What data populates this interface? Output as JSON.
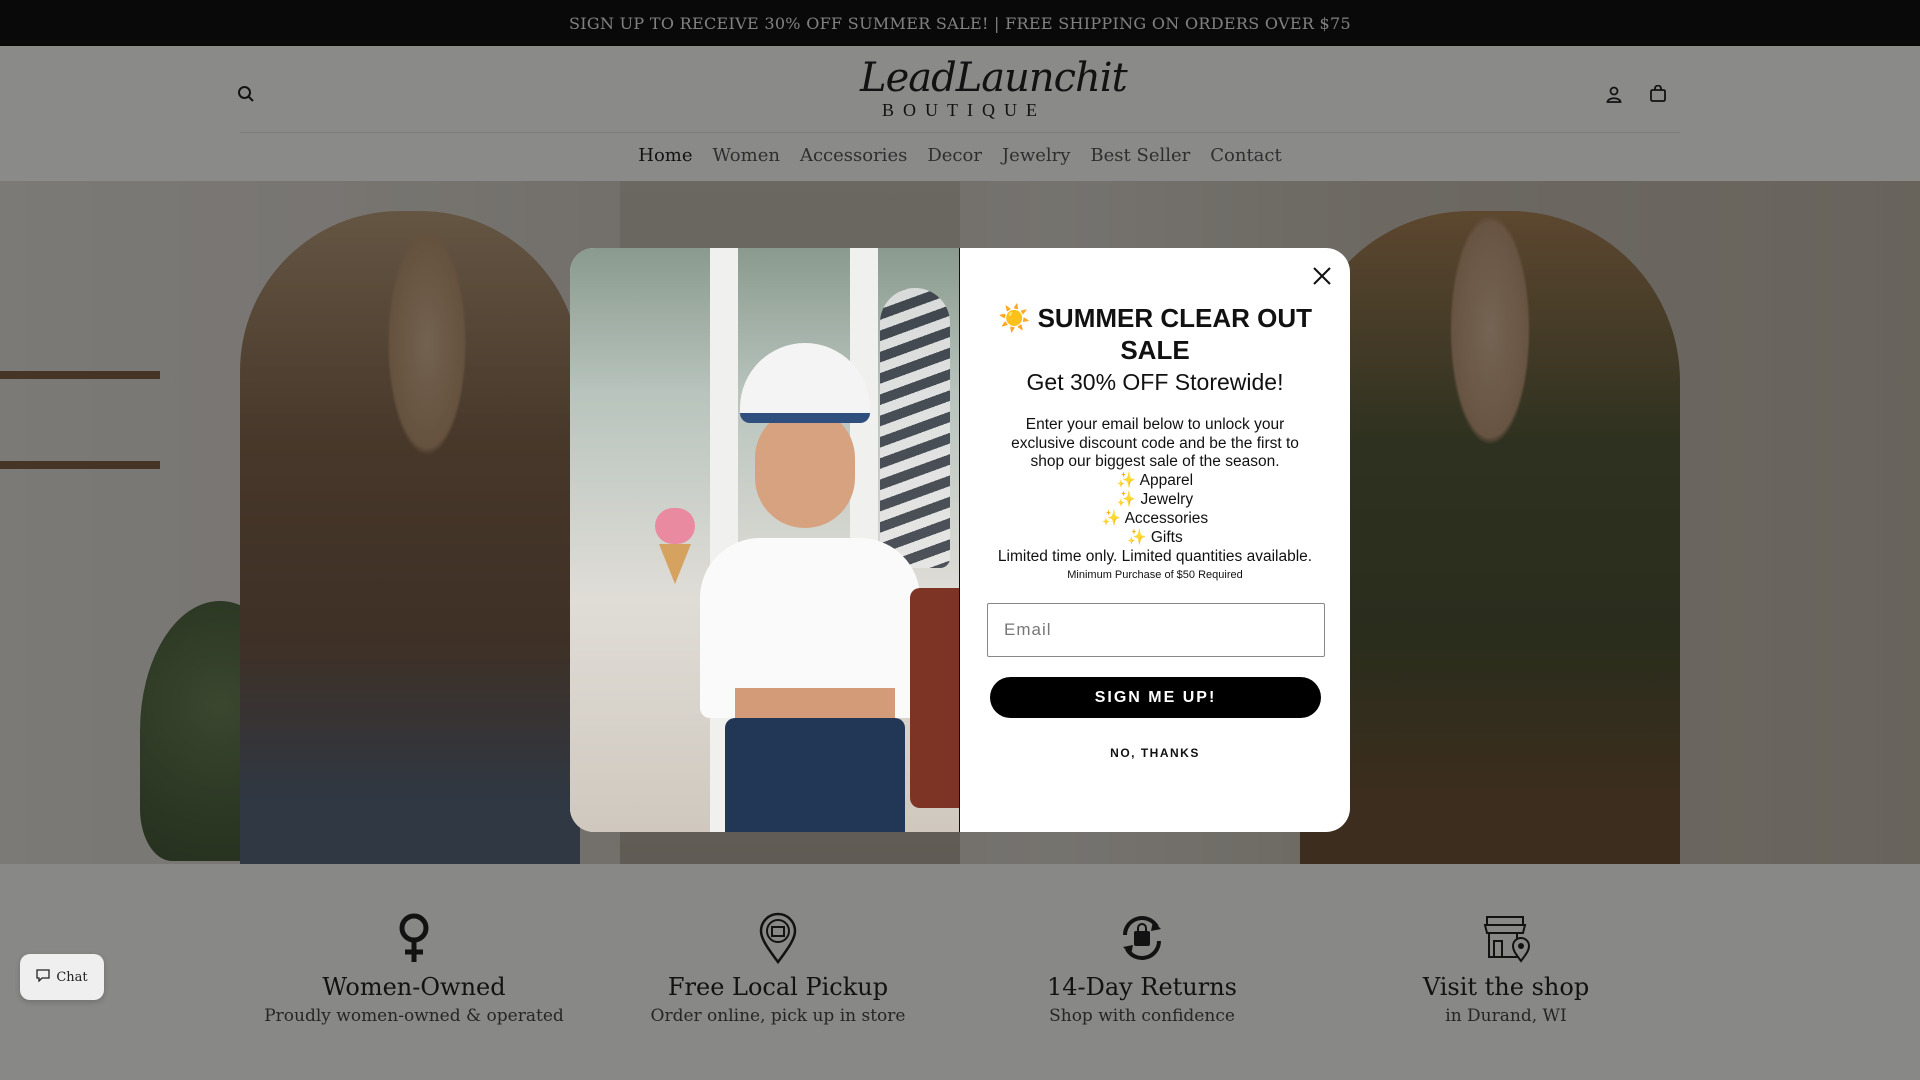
{
  "announcement": {
    "text": "SIGN UP TO RECEIVE 30% OFF SUMMER SALE! | FREE SHIPPING ON ORDERS OVER $75"
  },
  "header": {
    "logo_script": "LeadLaunchit",
    "logo_sub": "BOUTIQUE",
    "icons": [
      "search-icon",
      "account-icon",
      "cart-icon"
    ]
  },
  "nav": {
    "items": [
      {
        "label": "Home",
        "active": true
      },
      {
        "label": "Women"
      },
      {
        "label": "Accessories"
      },
      {
        "label": "Decor"
      },
      {
        "label": "Jewelry"
      },
      {
        "label": "Best Seller"
      },
      {
        "label": "Contact"
      }
    ]
  },
  "popup": {
    "title_emoji": "☀️",
    "title": "SUMMER CLEAR OUT SALE",
    "subtitle": "Get 30% OFF Storewide!",
    "description": "Enter your email below to unlock your exclusive discount code and be the first to shop our biggest sale of the season.",
    "list": [
      "✨ Apparel",
      "✨ Jewelry",
      "✨ Accessories",
      "✨ Gifts"
    ],
    "limited": "Limited time only. Limited quantities available.",
    "minimum": "Minimum Purchase of $50 Required",
    "email_placeholder": "Email",
    "submit_label": "SIGN ME UP!",
    "decline_label": "NO, THANKS"
  },
  "features": [
    {
      "icon": "female-symbol-icon",
      "title": "Women-Owned",
      "subtitle": "Proudly women-owned & operated"
    },
    {
      "icon": "pickup-location-icon",
      "title": "Free Local Pickup",
      "subtitle": "Order online, pick up in store"
    },
    {
      "icon": "returns-icon",
      "title": "14-Day Returns",
      "subtitle": "Shop with confidence"
    },
    {
      "icon": "shop-location-icon",
      "title": "Visit the shop",
      "subtitle": "in Durand, WI"
    }
  ],
  "chat": {
    "label": "Chat"
  }
}
